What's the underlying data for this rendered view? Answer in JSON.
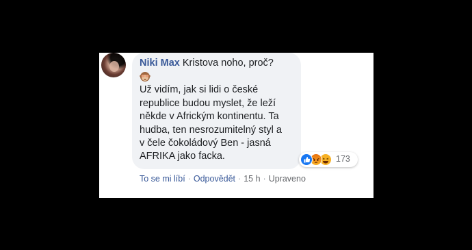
{
  "comment": {
    "author": "Niki Max",
    "first_line": " Kristova noho, proč?",
    "emoji": "see-no-evil-monkey",
    "body": "Už vidím, jak si lidi o české\nrepublice budou myslet, že leží\nněkde v Africkým kontinentu. Ta\nhudba, ten nesrozumitelný styl a\nv čele čokoládový Ben - jasná\nAFRIKA jako facka."
  },
  "reactions": {
    "icons": [
      "like-icon",
      "angry-icon",
      "haha-icon"
    ],
    "count": "173"
  },
  "actions": {
    "like": "To se mi líbí",
    "sep": "·",
    "reply": "Odpovědět",
    "time": "15 h",
    "edited": "Upraveno"
  },
  "colors": {
    "author": "#385898",
    "bubble": "#f0f2f5",
    "like": "#1877f2"
  }
}
